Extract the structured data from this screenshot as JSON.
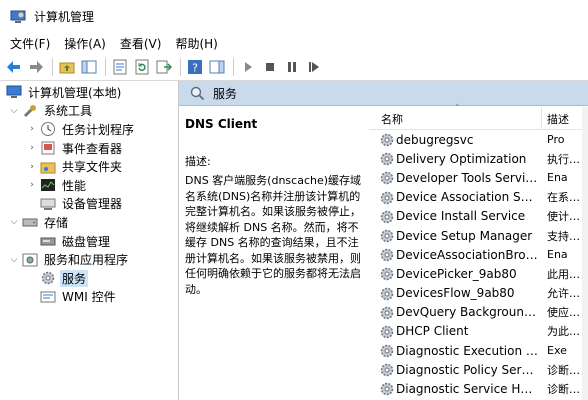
{
  "window": {
    "title": "计算机管理"
  },
  "menu": {
    "items": [
      "文件(F)",
      "操作(A)",
      "查看(V)",
      "帮助(H)"
    ]
  },
  "toolbar": {
    "icons": [
      "back-arrow-icon",
      "forward-arrow-icon",
      "up-folder-icon",
      "show-hide-tree-icon",
      "properties-icon",
      "refresh-icon",
      "export-list-icon",
      "help-icon",
      "action-pane-icon",
      "play-icon",
      "stop-icon",
      "pause-icon",
      "restart-icon"
    ]
  },
  "tree": {
    "root": "计算机管理(本地)",
    "system_tools": "系统工具",
    "task_scheduler": "任务计划程序",
    "event_viewer": "事件查看器",
    "shared_folders": "共享文件夹",
    "performance": "性能",
    "device_manager": "设备管理器",
    "storage": "存储",
    "disk_management": "磁盘管理",
    "services_apps": "服务和应用程序",
    "services": "服务",
    "wmi": "WMI 控件"
  },
  "panel": {
    "header": "服务",
    "service_title": "DNS Client",
    "description_label": "描述:",
    "description_text": "DNS 客户端服务(dnscache)缓存域名系统(DNS)名称并注册该计算机的完整计算机名。如果该服务被停止，将继续解析 DNS 名称。然而，将不缓存 DNS 名称的查询结果，且不注册计算机名。如果该服务被禁用，则任何明确依赖于它的服务都将无法启动。"
  },
  "list": {
    "col_name": "名称",
    "col_desc": "描述",
    "rows": [
      {
        "name": "debugregsvc",
        "desc": "Pro"
      },
      {
        "name": "Delivery Optimization",
        "desc": "执行…"
      },
      {
        "name": "Developer Tools Service",
        "desc": "Ena"
      },
      {
        "name": "Device Association Service",
        "desc": "在系…"
      },
      {
        "name": "Device Install Service",
        "desc": "使计…"
      },
      {
        "name": "Device Setup Manager",
        "desc": "支持…"
      },
      {
        "name": "DeviceAssociationBroker…",
        "desc": "Ena"
      },
      {
        "name": "DevicePicker_9ab80",
        "desc": "此用…"
      },
      {
        "name": "DevicesFlow_9ab80",
        "desc": "允许…"
      },
      {
        "name": "DevQuery Background D…",
        "desc": "使应…"
      },
      {
        "name": "DHCP Client",
        "desc": "为此…"
      },
      {
        "name": "Diagnostic Execution Ser…",
        "desc": "Exe"
      },
      {
        "name": "Diagnostic Policy Service",
        "desc": "诊断…"
      },
      {
        "name": "Diagnostic Service Host",
        "desc": "诊断…"
      }
    ]
  },
  "colors": {
    "header_bg": "#c9daed",
    "selection": "#cce4f7",
    "accent_green": "#2e8b57",
    "accent_blue": "#1f6fc5"
  }
}
